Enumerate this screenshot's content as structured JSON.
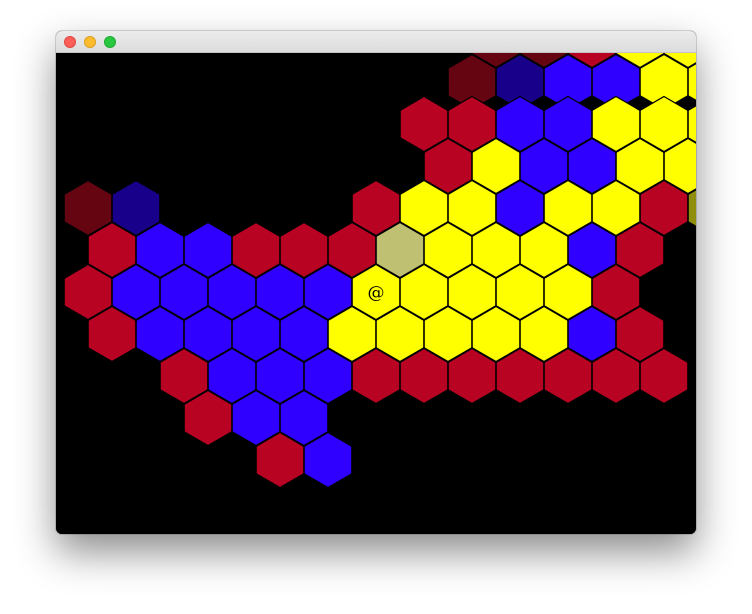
{
  "window": {
    "buttons": [
      "close",
      "minimize",
      "zoom"
    ]
  },
  "board": {
    "player_glyph": "@",
    "colors": {
      "R": "#b80323",
      "B": "#2f00ff",
      "Y": "#ffff00",
      "D": "#650512",
      "N": "#19008a",
      "G": "#bfc072",
      "O": "#8f8f0d",
      "background": "#000000"
    },
    "cells": [
      {
        "col": 8,
        "row": -1,
        "t": "D"
      },
      {
        "col": 9,
        "row": -1,
        "t": "D"
      },
      {
        "col": 10,
        "row": -1,
        "t": "R"
      },
      {
        "col": 11,
        "row": -1,
        "t": "Y"
      },
      {
        "col": 12,
        "row": -1,
        "t": "Y"
      },
      {
        "col": 13,
        "row": -1,
        "t": "R"
      },
      {
        "col": 8,
        "row": 0,
        "t": "D"
      },
      {
        "col": 9,
        "row": 0,
        "t": "N"
      },
      {
        "col": 10,
        "row": 0,
        "t": "B"
      },
      {
        "col": 11,
        "row": 0,
        "t": "B"
      },
      {
        "col": 12,
        "row": 0,
        "t": "Y"
      },
      {
        "col": 13,
        "row": 0,
        "t": "Y"
      },
      {
        "col": 7,
        "row": 1,
        "t": "R"
      },
      {
        "col": 8,
        "row": 1,
        "t": "R"
      },
      {
        "col": 9,
        "row": 1,
        "t": "B"
      },
      {
        "col": 10,
        "row": 1,
        "t": "B"
      },
      {
        "col": 11,
        "row": 1,
        "t": "Y"
      },
      {
        "col": 12,
        "row": 1,
        "t": "Y"
      },
      {
        "col": 13,
        "row": 1,
        "t": "Y"
      },
      {
        "col": 7,
        "row": 2,
        "t": "R"
      },
      {
        "col": 8,
        "row": 2,
        "t": "Y"
      },
      {
        "col": 9,
        "row": 2,
        "t": "B"
      },
      {
        "col": 10,
        "row": 2,
        "t": "B"
      },
      {
        "col": 11,
        "row": 2,
        "t": "Y"
      },
      {
        "col": 12,
        "row": 2,
        "t": "Y"
      },
      {
        "col": 13,
        "row": 2,
        "t": "Y"
      },
      {
        "col": 0,
        "row": 3,
        "t": "D"
      },
      {
        "col": 1,
        "row": 3,
        "t": "N"
      },
      {
        "col": 6,
        "row": 3,
        "t": "R"
      },
      {
        "col": 7,
        "row": 3,
        "t": "Y"
      },
      {
        "col": 8,
        "row": 3,
        "t": "Y"
      },
      {
        "col": 9,
        "row": 3,
        "t": "B"
      },
      {
        "col": 10,
        "row": 3,
        "t": "Y"
      },
      {
        "col": 11,
        "row": 3,
        "t": "Y"
      },
      {
        "col": 12,
        "row": 3,
        "t": "R"
      },
      {
        "col": 13,
        "row": 3,
        "t": "O"
      },
      {
        "col": 0,
        "row": 4,
        "t": "R"
      },
      {
        "col": 1,
        "row": 4,
        "t": "B"
      },
      {
        "col": 2,
        "row": 4,
        "t": "B"
      },
      {
        "col": 3,
        "row": 4,
        "t": "R"
      },
      {
        "col": 4,
        "row": 4,
        "t": "R"
      },
      {
        "col": 5,
        "row": 4,
        "t": "R"
      },
      {
        "col": 6,
        "row": 4,
        "t": "G"
      },
      {
        "col": 7,
        "row": 4,
        "t": "Y"
      },
      {
        "col": 8,
        "row": 4,
        "t": "Y"
      },
      {
        "col": 9,
        "row": 4,
        "t": "Y"
      },
      {
        "col": 10,
        "row": 4,
        "t": "B"
      },
      {
        "col": 11,
        "row": 4,
        "t": "R"
      },
      {
        "col": 0,
        "row": 5,
        "t": "R"
      },
      {
        "col": 1,
        "row": 5,
        "t": "B"
      },
      {
        "col": 2,
        "row": 5,
        "t": "B"
      },
      {
        "col": 3,
        "row": 5,
        "t": "B"
      },
      {
        "col": 4,
        "row": 5,
        "t": "B"
      },
      {
        "col": 5,
        "row": 5,
        "t": "B"
      },
      {
        "col": 6,
        "row": 5,
        "t": "Y",
        "player": true
      },
      {
        "col": 7,
        "row": 5,
        "t": "Y"
      },
      {
        "col": 8,
        "row": 5,
        "t": "Y"
      },
      {
        "col": 9,
        "row": 5,
        "t": "Y"
      },
      {
        "col": 10,
        "row": 5,
        "t": "Y"
      },
      {
        "col": 11,
        "row": 5,
        "t": "R"
      },
      {
        "col": 0,
        "row": 6,
        "t": "R"
      },
      {
        "col": 1,
        "row": 6,
        "t": "B"
      },
      {
        "col": 2,
        "row": 6,
        "t": "B"
      },
      {
        "col": 3,
        "row": 6,
        "t": "B"
      },
      {
        "col": 4,
        "row": 6,
        "t": "B"
      },
      {
        "col": 5,
        "row": 6,
        "t": "Y"
      },
      {
        "col": 6,
        "row": 6,
        "t": "Y"
      },
      {
        "col": 7,
        "row": 6,
        "t": "Y"
      },
      {
        "col": 8,
        "row": 6,
        "t": "Y"
      },
      {
        "col": 9,
        "row": 6,
        "t": "Y"
      },
      {
        "col": 10,
        "row": 6,
        "t": "B"
      },
      {
        "col": 11,
        "row": 6,
        "t": "R"
      },
      {
        "col": 1,
        "row": 7,
        "t": "R"
      },
      {
        "col": 2,
        "row": 7,
        "t": "B"
      },
      {
        "col": 3,
        "row": 7,
        "t": "B"
      },
      {
        "col": 4,
        "row": 7,
        "t": "B"
      },
      {
        "col": 5,
        "row": 7,
        "t": "R"
      },
      {
        "col": 6,
        "row": 7,
        "t": "R"
      },
      {
        "col": 7,
        "row": 7,
        "t": "R"
      },
      {
        "col": 8,
        "row": 7,
        "t": "R"
      },
      {
        "col": 9,
        "row": 7,
        "t": "R"
      },
      {
        "col": 10,
        "row": 7,
        "t": "R"
      },
      {
        "col": 11,
        "row": 7,
        "t": "R"
      },
      {
        "col": 1,
        "row": 8,
        "t": "R"
      },
      {
        "col": 2,
        "row": 8,
        "t": "B"
      },
      {
        "col": 3,
        "row": 8,
        "t": "B"
      },
      {
        "col": 2,
        "row": 9,
        "t": "R"
      },
      {
        "col": 3,
        "row": 9,
        "t": "B"
      }
    ]
  }
}
